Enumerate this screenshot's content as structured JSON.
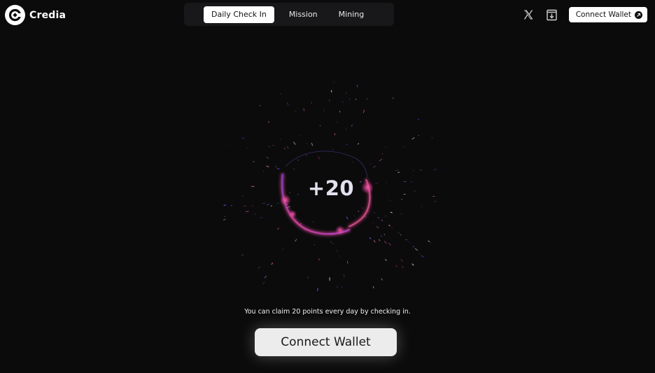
{
  "brand": {
    "name": "Credia",
    "logo_icon": "credia-logo-icon"
  },
  "nav": {
    "tabs": [
      {
        "label": "Daily Check In",
        "active": true
      },
      {
        "label": "Mission",
        "active": false
      },
      {
        "label": "Mining",
        "active": false
      }
    ]
  },
  "header": {
    "icons": [
      "x-twitter-icon",
      "docs-download-icon",
      "arrow-up-right-icon"
    ],
    "connect_wallet_label": "Connect Wallet"
  },
  "hero": {
    "points": "+20",
    "claim_text": "You can claim 20 points every day by checking in.",
    "connect_wallet_label": "Connect Wallet"
  },
  "colors": {
    "background": "#0b0b0c",
    "accent_pink": "#ff3fa0",
    "accent_purple": "#7a4cff"
  }
}
